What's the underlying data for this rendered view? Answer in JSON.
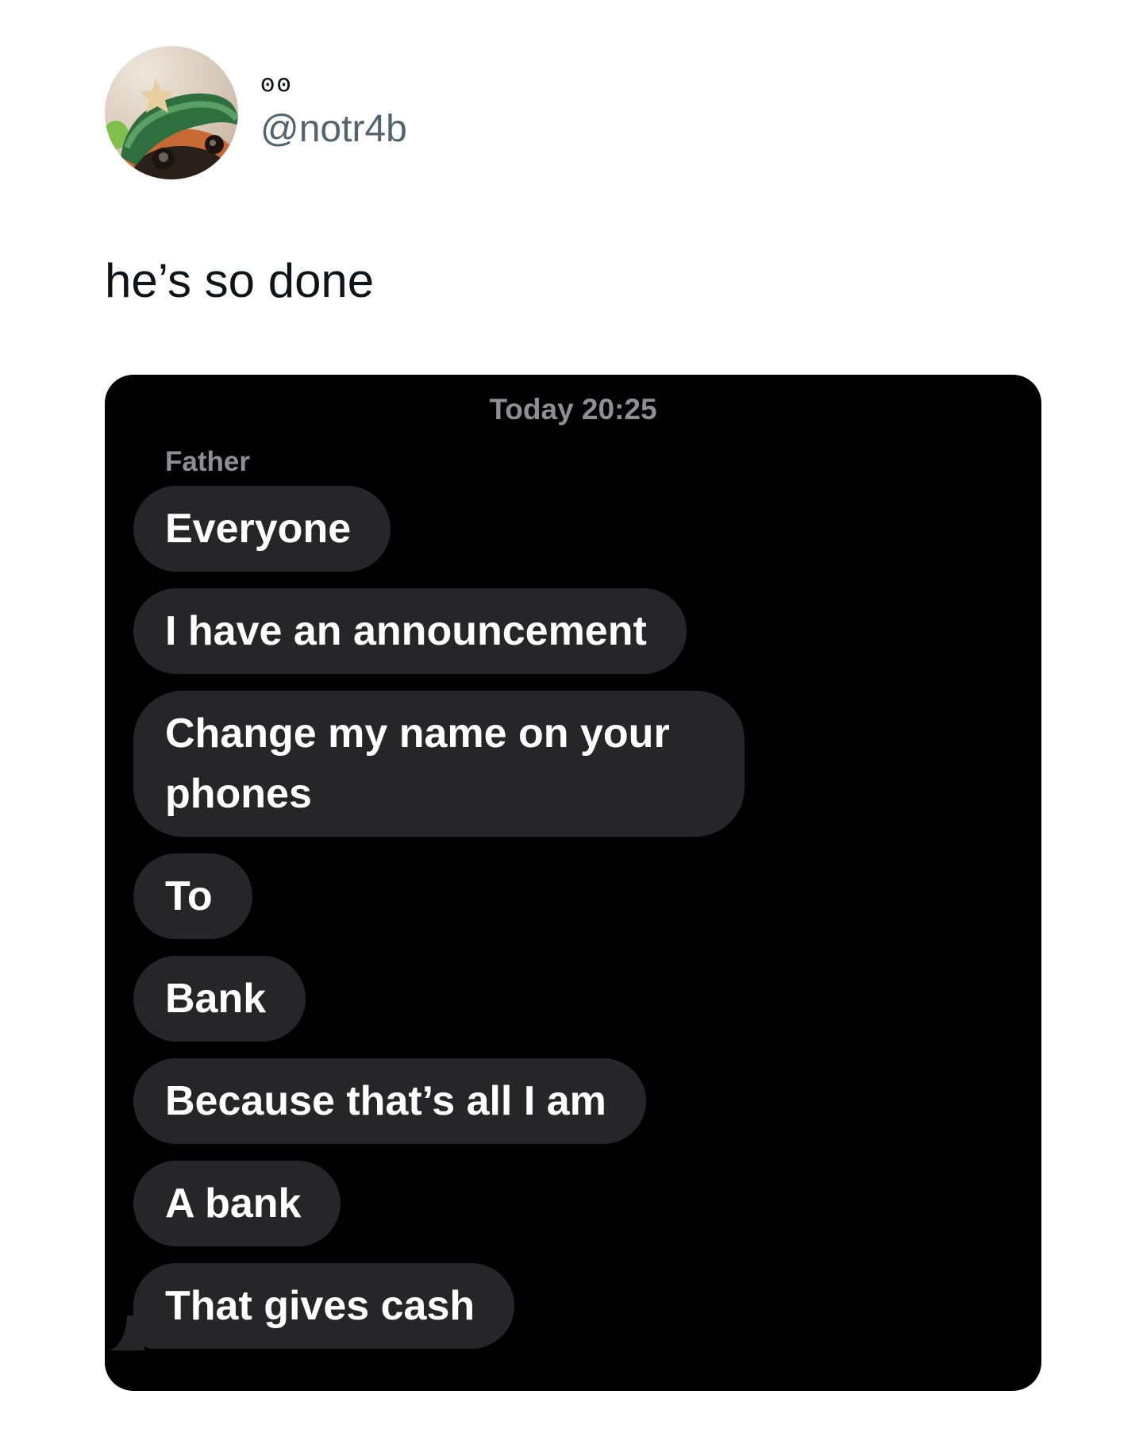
{
  "tweet": {
    "display_name": "ꙩꙩ",
    "handle": "@notr4b",
    "avatar_icon": "avatar-cat-photo-icon",
    "text": "he’s so done"
  },
  "screenshot": {
    "timestamp": "Today 20:25",
    "sender": "Father",
    "bubble_color": "#262629",
    "messages": [
      "Everyone",
      "I have an announcement",
      "Change my name on your phones",
      "To",
      "Bank",
      "Because that’s all I am",
      "A bank",
      "That gives cash"
    ]
  }
}
